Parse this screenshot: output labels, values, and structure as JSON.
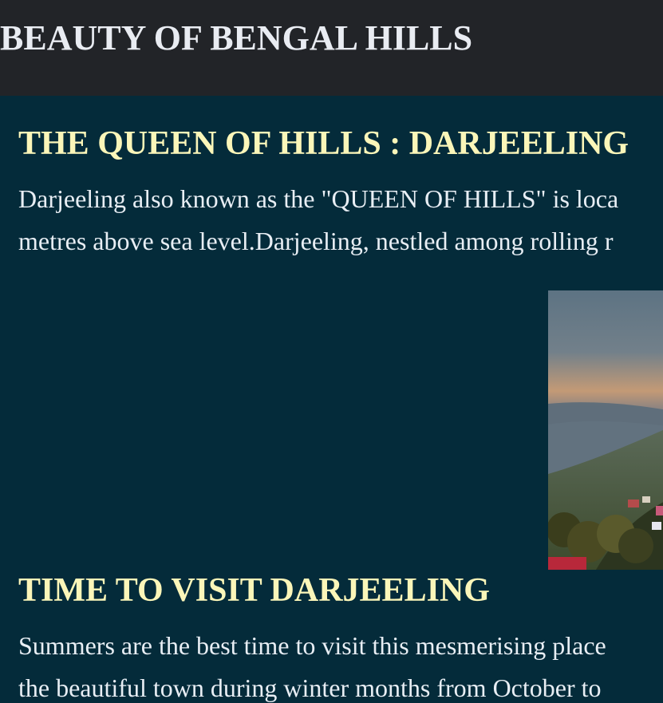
{
  "header": {
    "title": "BEAUTY OF BENGAL HILLS"
  },
  "sections": [
    {
      "heading": "THE QUEEN OF HILLS : DARJEELING",
      "lines": [
        "Darjeeling also known as the \"QUEEN OF HILLS\" is loca",
        "metres above sea level.Darjeeling, nestled among rolling r"
      ]
    },
    {
      "heading": "TIME TO VISIT DARJEELING",
      "lines": [
        "Summers are the best time to visit this mesmerising place",
        "the beautiful town during winter months from October to"
      ]
    }
  ],
  "colors": {
    "header_bg": "#222428",
    "page_bg": "#042b3a",
    "heading": "#fbf6b9",
    "body_text": "#e8eef4"
  }
}
